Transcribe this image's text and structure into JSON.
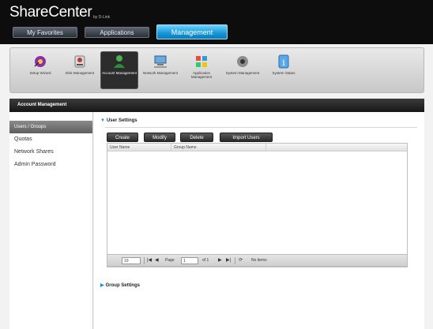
{
  "header": {
    "brand": "ShareCenter",
    "brand_sub": "by D-Link",
    "tabs": [
      {
        "label": "My Favorites",
        "active": false
      },
      {
        "label": "Applications",
        "active": false
      },
      {
        "label": "Management",
        "active": true
      }
    ]
  },
  "iconbar": {
    "items": [
      {
        "label": "Setup Wizard",
        "icon": "wizard-icon"
      },
      {
        "label": "Disk Management",
        "icon": "disk-icon"
      },
      {
        "label": "Account Management",
        "icon": "account-icon",
        "active": true
      },
      {
        "label": "Network Management",
        "icon": "network-icon"
      },
      {
        "label": "Application Management",
        "icon": "application-icon"
      },
      {
        "label": "System Management",
        "icon": "system-icon"
      },
      {
        "label": "System Status",
        "icon": "info-icon"
      }
    ]
  },
  "section": {
    "title": "Account Management"
  },
  "sidebar": {
    "items": [
      {
        "label": "Users / Groups",
        "active": true
      },
      {
        "label": "Quotas"
      },
      {
        "label": "Network Shares"
      },
      {
        "label": "Admin Password"
      }
    ]
  },
  "user_settings": {
    "title": "User Settings",
    "buttons": {
      "create": "Create",
      "modify": "Modify",
      "delete": "Delete",
      "import": "Import Users"
    },
    "columns": {
      "user": "User Name",
      "group": "Group Name"
    },
    "pager": {
      "page_size": "10",
      "page_label": "Page",
      "page_value": "1",
      "of_label": "of 1",
      "status": "No items"
    }
  },
  "group_settings": {
    "title": "Group Settings"
  },
  "colors": {
    "accent": "#1596d6",
    "header_bg": "#0d0d0d"
  }
}
